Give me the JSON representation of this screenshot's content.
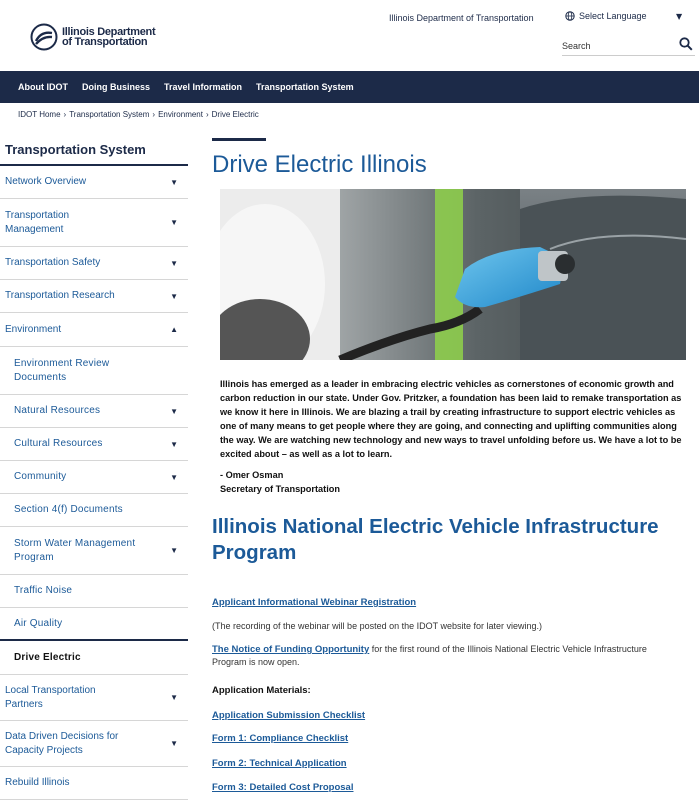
{
  "header": {
    "logo_line1": "Illinois Department",
    "logo_line2": "of Transportation",
    "top_link": "Illinois Department of Transportation",
    "language": "Select Language",
    "search_placeholder": "Search"
  },
  "nav": {
    "items": [
      "About IDOT",
      "Doing Business",
      "Travel Information",
      "Transportation System"
    ]
  },
  "breadcrumb": [
    "IDOT Home",
    "Transportation System",
    "Environment",
    "Drive Electric"
  ],
  "sidebar": {
    "title": "Transportation System",
    "items": [
      {
        "label": "Network Overview"
      },
      {
        "label": "Transportation Management"
      },
      {
        "label": "Transportation Safety"
      },
      {
        "label": "Transportation Research"
      },
      {
        "label": "Environment"
      },
      {
        "label": "Environment Review Documents"
      },
      {
        "label": "Natural Resources"
      },
      {
        "label": "Cultural Resources"
      },
      {
        "label": "Community"
      },
      {
        "label": "Section 4(f) Documents"
      },
      {
        "label": "Storm Water Management Program"
      },
      {
        "label": "Traffic Noise"
      },
      {
        "label": "Air Quality"
      },
      {
        "label": "Drive Electric"
      },
      {
        "label": "Local Transportation Partners"
      },
      {
        "label": "Data Driven Decisions for Capacity Projects"
      },
      {
        "label": "Rebuild Illinois"
      }
    ]
  },
  "main": {
    "title": "Drive Electric Illinois",
    "intro": "Illinois has emerged as a leader in embracing electric vehicles as cornerstones of economic growth and carbon reduction in our state. Under Gov. Pritzker, a foundation has been laid to remake transportation as we know it here in Illinois. We are blazing a trail by creating infrastructure to support electric vehicles as one of many means to get people where they are going, and connecting and uplifting communities along the way. We are watching new technology and new ways to travel unfolding before us. We have a lot to be excited about – as well as a lot to learn.",
    "quote_author": "- Omer Osman",
    "quote_role": "Secretary of Transportation",
    "section_title": "Illinois National Electric Vehicle Infrastructure Program",
    "webinar_link": "Applicant Informational Webinar Registration",
    "webinar_note": "(The recording of the webinar will be posted on the IDOT website for later viewing.)",
    "nofo_link": "The Notice of Funding Opportunity",
    "nofo_text": " for the first round of the Illinois National Electric Vehicle Infrastructure Program is now open.",
    "materials_heading": "Application Materials:",
    "materials": [
      "Application Submission Checklist",
      "Form 1: Compliance Checklist",
      "Form 2: Technical Application",
      "Form 3: Detailed Cost Proposal"
    ]
  }
}
